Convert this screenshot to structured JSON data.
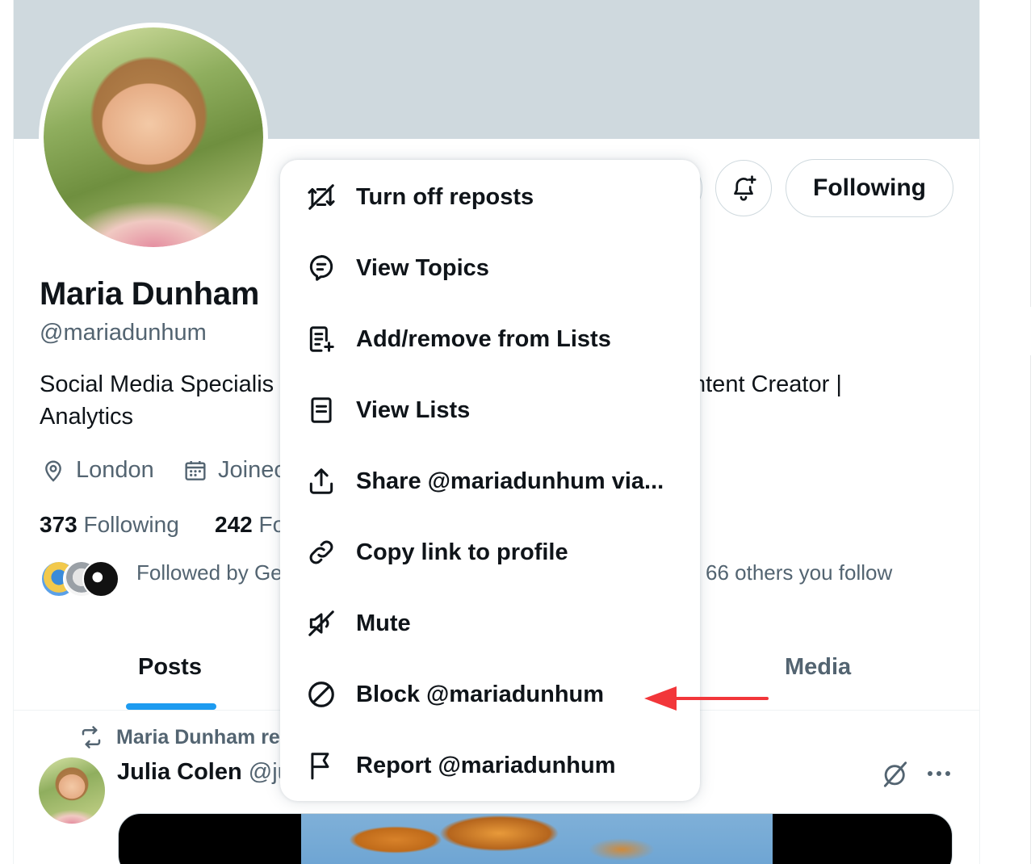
{
  "profile": {
    "name": "Maria Dunham",
    "handle": "@mariadunhum",
    "bio_line1_left": "Social Media Specialis",
    "bio_line1_right": "ntent Creator |",
    "bio_line2": "Analytics",
    "location": "London",
    "joined": "Joinec",
    "following_count": "373",
    "following_label": "Following",
    "followers_count": "242",
    "followers_label": "Fo",
    "followed_by_left": "Followed by Ge",
    "followed_by_right": "66 others you follow"
  },
  "actions": {
    "following_button": "Following"
  },
  "tabs": {
    "posts": "Posts",
    "media": "Media"
  },
  "post": {
    "repost_label": "Maria Dunham re",
    "author_name": "Julia Colen",
    "author_handle": "@ju"
  },
  "menu": {
    "items": [
      {
        "label": "Turn off reposts",
        "icon": "repost-off-icon"
      },
      {
        "label": "View Topics",
        "icon": "topics-icon"
      },
      {
        "label": "Add/remove from Lists",
        "icon": "list-add-icon"
      },
      {
        "label": "View Lists",
        "icon": "list-icon"
      },
      {
        "label": "Share @mariadunhum via...",
        "icon": "share-icon"
      },
      {
        "label": "Copy link to profile",
        "icon": "link-icon"
      },
      {
        "label": "Mute",
        "icon": "mute-icon"
      },
      {
        "label": "Block @mariadunhum",
        "icon": "block-icon"
      },
      {
        "label": "Report @mariadunhum",
        "icon": "flag-icon"
      }
    ]
  },
  "colors": {
    "accent": "#1d9bf0",
    "banner": "#cfd9de",
    "annotation_arrow": "#f2363a",
    "muted_text": "#536471"
  }
}
